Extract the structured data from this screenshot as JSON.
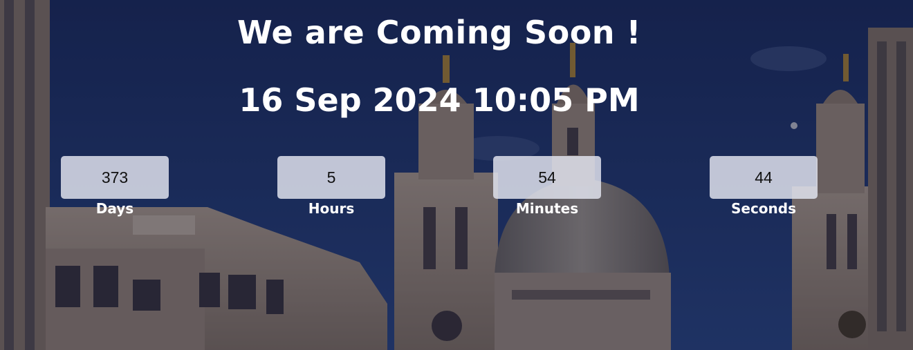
{
  "headline": "We are Coming Soon !",
  "launch_datetime": "16 Sep 2024 10:05 PM",
  "countdown": [
    {
      "value": "373",
      "label": "Days"
    },
    {
      "value": "5",
      "label": "Hours"
    },
    {
      "value": "54",
      "label": "Minutes"
    },
    {
      "value": "44",
      "label": "Seconds"
    }
  ],
  "colors": {
    "sky": "#233a7a",
    "stone": "#a8968a",
    "text": "#ffffff",
    "box": "#e1e4ee"
  }
}
